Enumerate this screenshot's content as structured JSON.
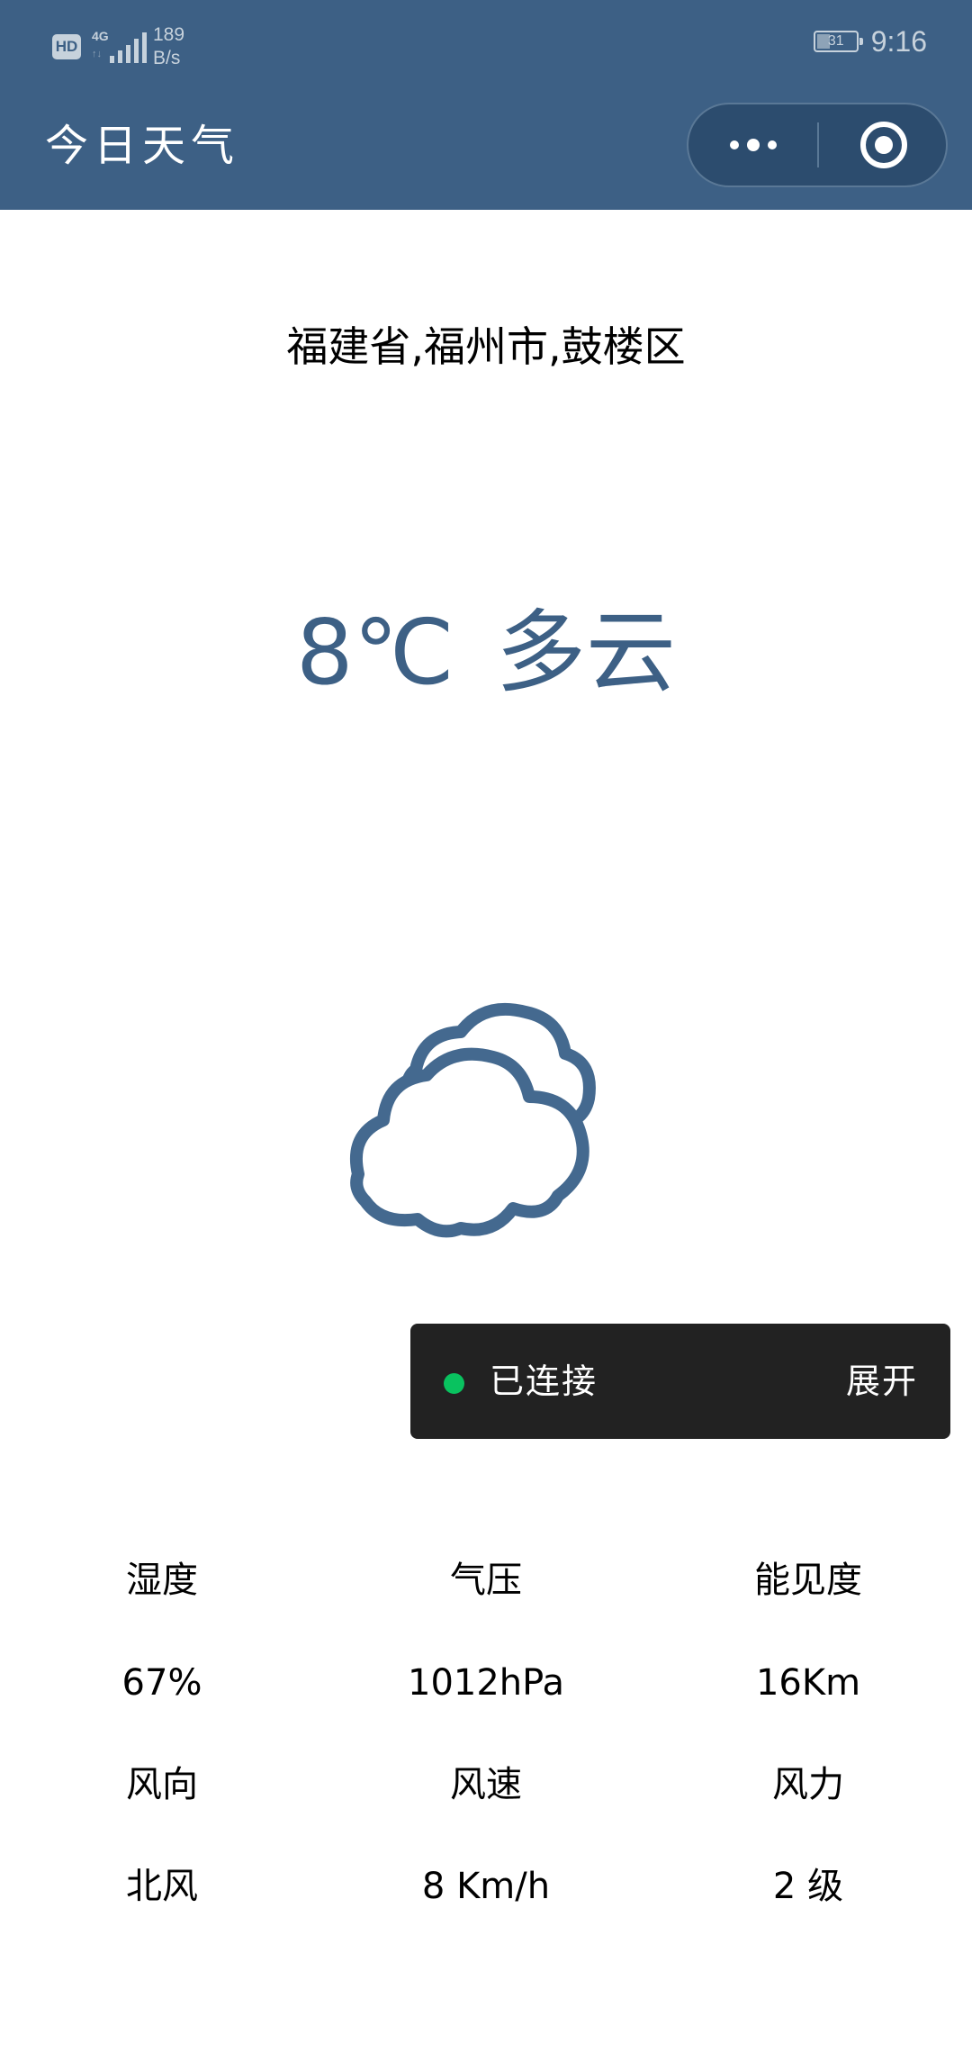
{
  "status_bar": {
    "hd_badge": "HD",
    "network_type": "4G",
    "network_arrows": "↑↓",
    "net_speed_value": "189",
    "net_speed_unit": "B/s",
    "battery_level": "31",
    "time": "9:16",
    "signal_icon": "signal-bars-icon",
    "battery_icon": "battery-icon"
  },
  "nav": {
    "title": "今日天气",
    "more_icon": "more-dots-icon",
    "close_icon": "target-close-icon",
    "bar_color": "#3d6085"
  },
  "location": "福建省,福州市,鼓楼区",
  "current": {
    "temperature": "8℃",
    "condition": "多云",
    "condition_icon": "partly-cloudy-icon",
    "accent_color": "#3d6085"
  },
  "toast": {
    "status": "已连接",
    "expand_label": "展开",
    "dot_color": "#09c25f"
  },
  "details": {
    "rows": [
      [
        "湿度",
        "气压",
        "能见度"
      ],
      [
        "67%",
        "1012hPa",
        "16Km"
      ],
      [
        "风向",
        "风速",
        "风力"
      ],
      [
        "北风",
        "8 Km/h",
        "2 级"
      ]
    ]
  }
}
